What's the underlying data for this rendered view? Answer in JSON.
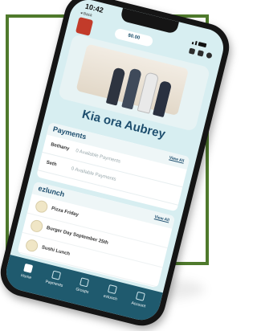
{
  "status": {
    "time": "10:42"
  },
  "nav": {
    "back": "◂ Back"
  },
  "balance": {
    "amount": "$0.00"
  },
  "greeting": "Kia ora Aubrey",
  "payments": {
    "title": "Payments",
    "view_all": "View All",
    "items": [
      {
        "name": "Bethany",
        "meta": "0 Available Payments"
      },
      {
        "name": "Seth",
        "meta": "0 Available Payments"
      }
    ]
  },
  "ezlunch": {
    "title": "ezlunch",
    "view_all": "View All",
    "items": [
      {
        "name": "Pizza Friday"
      },
      {
        "name": "Burger Day September 25th"
      },
      {
        "name": "Sushi Lunch"
      }
    ]
  },
  "tabbar": {
    "tabs": [
      {
        "label": "Home",
        "icon": "home-icon",
        "active": true
      },
      {
        "label": "Payments",
        "icon": "payments-icon",
        "active": false
      },
      {
        "label": "Groups",
        "icon": "groups-icon",
        "active": false
      },
      {
        "label": "ezlunch",
        "icon": "ezlunch-icon",
        "active": false
      },
      {
        "label": "Account",
        "icon": "account-icon",
        "active": false
      }
    ]
  },
  "colors": {
    "frame": "#4f7a2c",
    "brand": "#1d4e6e",
    "tabbar": "#1f5a6e",
    "screen": "#d7eef1"
  }
}
